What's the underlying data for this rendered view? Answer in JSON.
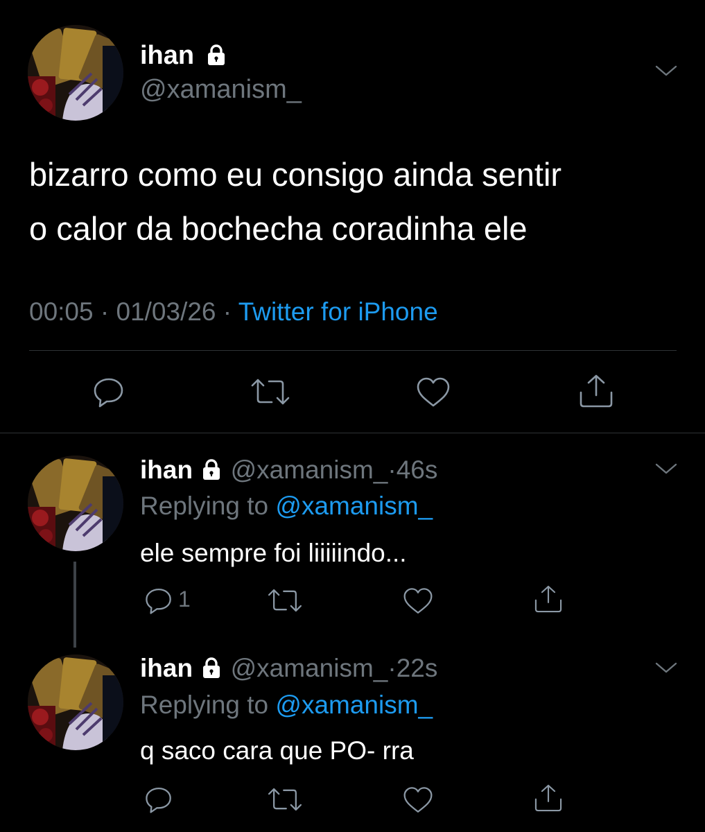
{
  "main_tweet": {
    "display_name": "ihan",
    "handle": "@xamanism_",
    "text_line1": "bizarro como eu consigo ainda sentir",
    "text_line2": "o calor da bochecha coradinha ele",
    "time": "00:05",
    "date": "01/03/26",
    "source": "Twitter for iPhone",
    "separator": "·"
  },
  "replies": [
    {
      "display_name": "ihan",
      "handle": "@xamanism_",
      "separator": "·",
      "age": "46s",
      "replying_prefix": "Replying to",
      "replying_handle": "@xamanism_",
      "text": "ele sempre foi liiiiindo...",
      "reply_count": "1"
    },
    {
      "display_name": "ihan",
      "handle": "@xamanism_",
      "separator": "·",
      "age": "22s",
      "replying_prefix": "Replying to",
      "replying_handle": "@xamanism_",
      "text": "q saco cara que PO- rra",
      "reply_count": ""
    }
  ],
  "icons": [
    "lock-icon",
    "chevron-down-icon",
    "reply-icon",
    "retweet-icon",
    "like-icon",
    "share-icon"
  ],
  "colors": {
    "background": "#000000",
    "text": "#ffffff",
    "muted": "#6e767d",
    "link": "#1d9bf0",
    "divider": "#2f3336"
  }
}
